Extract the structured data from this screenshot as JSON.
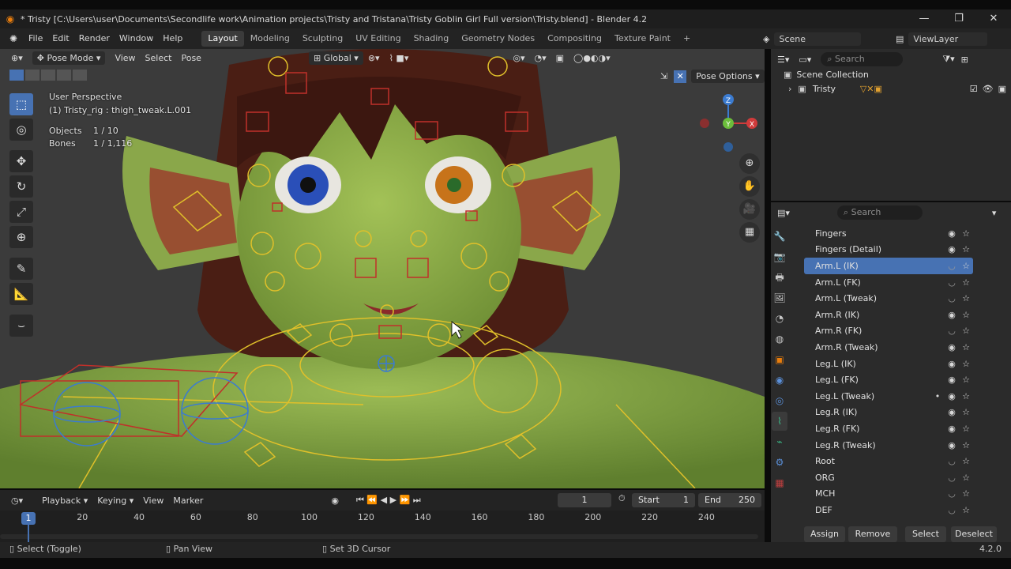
{
  "window": {
    "title": "* Tristy [C:\\Users\\user\\Documents\\Secondlife work\\Animation projects\\Tristy and Tristana\\Tristy Goblin Girl Full version\\Tristy.blend] - Blender 4.2",
    "minimize": "—",
    "maximize": "❐",
    "close": "✕"
  },
  "menu": [
    "File",
    "Edit",
    "Render",
    "Window",
    "Help"
  ],
  "workspaces": [
    "Layout",
    "Modeling",
    "Sculpting",
    "UV Editing",
    "Shading",
    "Geometry Nodes",
    "Compositing",
    "Texture Paint",
    "+"
  ],
  "scene": {
    "label": "Scene",
    "view_layer": "ViewLayer"
  },
  "viewport": {
    "mode": "Pose Mode",
    "menus": [
      "View",
      "Select",
      "Pose"
    ],
    "orientation": "Global",
    "pose_options": "Pose Options",
    "perspective": "User Perspective",
    "active": "(1) Tristy_rig : thigh_tweak.L.001",
    "objects_label": "Objects",
    "objects_value": "1 / 10",
    "bones_label": "Bones",
    "bones_value": "1 / 1,116",
    "axis_x": "X",
    "axis_y": "Y",
    "axis_z": "Z"
  },
  "outliner": {
    "search_placeholder": "Search",
    "scene_collection": "Scene Collection",
    "items": [
      {
        "name": "Tristy"
      }
    ]
  },
  "properties": {
    "search_placeholder": "Search",
    "collections": [
      {
        "name": "Fingers",
        "visible": true,
        "active": false,
        "dot": false
      },
      {
        "name": "Fingers (Detail)",
        "visible": true,
        "active": false,
        "dot": false
      },
      {
        "name": "Arm.L (IK)",
        "visible": false,
        "active": true,
        "dot": false
      },
      {
        "name": "Arm.L (FK)",
        "visible": false,
        "active": false,
        "dot": false
      },
      {
        "name": "Arm.L (Tweak)",
        "visible": false,
        "active": false,
        "dot": false
      },
      {
        "name": "Arm.R (IK)",
        "visible": true,
        "active": false,
        "dot": false
      },
      {
        "name": "Arm.R (FK)",
        "visible": false,
        "active": false,
        "dot": false
      },
      {
        "name": "Arm.R (Tweak)",
        "visible": true,
        "active": false,
        "dot": false
      },
      {
        "name": "Leg.L (IK)",
        "visible": true,
        "active": false,
        "dot": false
      },
      {
        "name": "Leg.L (FK)",
        "visible": true,
        "active": false,
        "dot": false
      },
      {
        "name": "Leg.L (Tweak)",
        "visible": true,
        "active": false,
        "dot": true
      },
      {
        "name": "Leg.R (IK)",
        "visible": true,
        "active": false,
        "dot": false
      },
      {
        "name": "Leg.R (FK)",
        "visible": true,
        "active": false,
        "dot": false
      },
      {
        "name": "Leg.R (Tweak)",
        "visible": true,
        "active": false,
        "dot": false
      },
      {
        "name": "Root",
        "visible": false,
        "active": false,
        "dot": false
      },
      {
        "name": "ORG",
        "visible": false,
        "active": false,
        "dot": false
      },
      {
        "name": "MCH",
        "visible": false,
        "active": false,
        "dot": false
      },
      {
        "name": "DEF",
        "visible": false,
        "active": false,
        "dot": false
      }
    ],
    "buttons": {
      "assign": "Assign",
      "remove": "Remove",
      "select": "Select",
      "deselect": "Deselect"
    }
  },
  "timeline": {
    "menus": [
      "Playback",
      "Keying",
      "View",
      "Marker"
    ],
    "current_frame": "1",
    "start_label": "Start",
    "start": "1",
    "end_label": "End",
    "end": "250",
    "ticks": [
      "20",
      "40",
      "60",
      "80",
      "100",
      "120",
      "140",
      "160",
      "180",
      "200",
      "220",
      "240"
    ]
  },
  "status": {
    "select": "Select (Toggle)",
    "pan": "Pan View",
    "cursor": "Set 3D Cursor",
    "version": "4.2.0"
  },
  "colors": {
    "accent": "#4772b3",
    "header": "#232323",
    "panel": "#2b2b2b",
    "skin": "#8fb04a",
    "rig": "#e0c02a",
    "rig_red": "#c0302a"
  }
}
